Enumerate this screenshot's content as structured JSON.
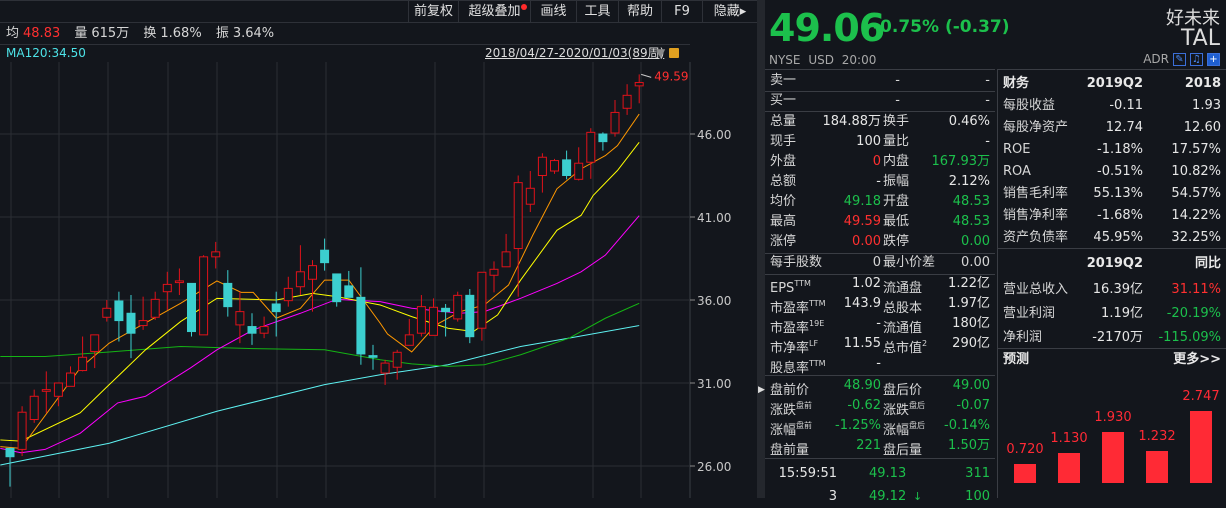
{
  "toolbar": {
    "items": [
      "前复权",
      "超级叠加",
      "画线",
      "工具",
      "帮助",
      "F9",
      "隐藏"
    ]
  },
  "stats": {
    "avg_label": "均",
    "avg": "48.83",
    "vol_label": "量",
    "vol": "615万",
    "turn_label": "换",
    "turn": "1.68%",
    "amp_label": "振",
    "amp": "3.64%"
  },
  "ma_label": "MA120:34.50",
  "date_range": "2018/04/27-2020/01/03(89周)",
  "colors": {
    "up": "#e0121a",
    "down": "#3ccfcf",
    "ma5": "#ff9800",
    "ma10": "#ffff00",
    "ma20": "#ff00ff",
    "ma60": "#14b414",
    "ma120": "#5ef2f2"
  },
  "chart_data": {
    "type": "candlestick",
    "ylim": [
      24,
      50
    ],
    "y_ticks": [
      "46.00",
      "41.00",
      "36.00",
      "31.00",
      "26.00"
    ],
    "y_tick_values": [
      46,
      41,
      36,
      31,
      26
    ],
    "high_label": "49.59",
    "candles": [
      [
        27.06,
        27.1,
        24.76,
        26.56
      ],
      [
        27.0,
        29.6,
        26.6,
        29.24
      ],
      [
        28.8,
        30.6,
        28.6,
        30.2
      ],
      [
        30.5,
        31.7,
        29.2,
        30.6
      ],
      [
        30.2,
        31.0,
        29.6,
        31.0
      ],
      [
        30.8,
        32.0,
        30.8,
        31.6
      ],
      [
        31.75,
        33.8,
        31.7,
        32.55
      ],
      [
        32.9,
        33.9,
        31.9,
        33.9
      ],
      [
        34.96,
        36.0,
        34.7,
        35.5
      ],
      [
        35.94,
        36.5,
        33.5,
        34.76
      ],
      [
        35.2,
        36.3,
        32.5,
        34.0
      ],
      [
        34.46,
        36.2,
        34.2,
        34.76
      ],
      [
        34.96,
        36.5,
        34.8,
        36.04
      ],
      [
        36.5,
        37.7,
        35.4,
        36.94
      ],
      [
        37.05,
        37.9,
        36.3,
        37.15
      ],
      [
        37.0,
        37.0,
        33.8,
        34.1
      ],
      [
        33.9,
        38.7,
        33.9,
        38.6
      ],
      [
        38.6,
        39.5,
        37.9,
        38.9
      ],
      [
        37.0,
        37.8,
        35.0,
        35.6
      ],
      [
        34.5,
        36.5,
        33.4,
        35.3
      ],
      [
        34.4,
        35.2,
        33.3,
        34.0
      ],
      [
        34.0,
        35.0,
        33.7,
        34.4
      ],
      [
        35.76,
        36.5,
        33.8,
        35.3
      ],
      [
        35.96,
        37.4,
        35.6,
        36.7
      ],
      [
        36.8,
        39.3,
        36.3,
        37.7
      ],
      [
        37.25,
        38.4,
        35.3,
        38.07
      ],
      [
        39.0,
        39.7,
        37.77,
        38.25
      ],
      [
        37.57,
        37.57,
        35.6,
        35.9
      ],
      [
        36.85,
        37.75,
        36.16,
        36.16
      ],
      [
        36.16,
        37.97,
        32.1,
        32.75
      ],
      [
        32.65,
        33.3,
        31.8,
        32.55
      ],
      [
        31.6,
        32.4,
        30.88,
        32.2
      ],
      [
        31.95,
        33.0,
        31.2,
        32.85
      ],
      [
        33.27,
        34.86,
        33.27,
        33.9
      ],
      [
        34.0,
        36.3,
        33.8,
        35.6
      ],
      [
        33.87,
        36.1,
        33.87,
        35.56
      ],
      [
        35.5,
        35.76,
        33.8,
        35.3
      ],
      [
        34.86,
        36.5,
        34.7,
        36.28
      ],
      [
        36.28,
        36.66,
        33.4,
        33.79
      ],
      [
        34.3,
        37.67,
        33.55,
        37.67
      ],
      [
        37.49,
        38.33,
        36.46,
        37.85
      ],
      [
        38.0,
        39.98,
        38.0,
        38.9
      ],
      [
        39.1,
        43.5,
        36.2,
        43.07
      ],
      [
        41.77,
        43.77,
        41.3,
        42.73
      ],
      [
        43.5,
        44.84,
        42.47,
        44.6
      ],
      [
        43.77,
        44.5,
        43.6,
        44.4
      ],
      [
        44.44,
        45.0,
        43.27,
        43.5
      ],
      [
        43.27,
        45.2,
        43.2,
        44.24
      ],
      [
        44.3,
        46.35,
        43.3,
        46.1
      ],
      [
        46.0,
        46.1,
        45.0,
        45.54
      ],
      [
        46.06,
        48.05,
        45.84,
        47.3
      ],
      [
        47.55,
        49.0,
        47.15,
        48.33
      ],
      [
        48.9,
        49.59,
        47.85,
        49.1
      ]
    ],
    "ma": {
      "ma5": [
        [
          0.2,
          27.17
        ],
        [
          1.9,
          27.06
        ],
        [
          6.8,
          31.9
        ],
        [
          9.2,
          33.4
        ],
        [
          15.1,
          35.8
        ],
        [
          18.1,
          37.15
        ],
        [
          20.1,
          36.46
        ],
        [
          21.1,
          36.46
        ],
        [
          23,
          34.9
        ],
        [
          25,
          35.5
        ],
        [
          27,
          37.2
        ],
        [
          29,
          37.2
        ],
        [
          31.6,
          34.6
        ],
        [
          32.2,
          33.95
        ],
        [
          34.2,
          32.87
        ],
        [
          36.2,
          34.5
        ],
        [
          38.2,
          35.3
        ],
        [
          40.2,
          35.7
        ],
        [
          42.2,
          36.9
        ],
        [
          44.2,
          39.9
        ],
        [
          46.2,
          42.7
        ],
        [
          48.2,
          43.9
        ],
        [
          50.2,
          44.7
        ],
        [
          51.2,
          45.3
        ],
        [
          53,
          47.2
        ]
      ],
      "ma10": [
        [
          0.2,
          27.57
        ],
        [
          1.9,
          27.5
        ],
        [
          6.8,
          29.2
        ],
        [
          9.2,
          30.9
        ],
        [
          12.2,
          33.0
        ],
        [
          15.1,
          34.7
        ],
        [
          18.1,
          36.1
        ],
        [
          23,
          36.0
        ],
        [
          26,
          36.4
        ],
        [
          28,
          36.2
        ],
        [
          31.6,
          35.7
        ],
        [
          34.2,
          35.0
        ],
        [
          37.2,
          34.3
        ],
        [
          39.3,
          34.1
        ],
        [
          41.3,
          35.1
        ],
        [
          43.2,
          37.2
        ],
        [
          46.2,
          40.2
        ],
        [
          48.2,
          41.1
        ],
        [
          49.2,
          42.3
        ],
        [
          51.2,
          43.8
        ],
        [
          53,
          45.5
        ]
      ],
      "ma20": [
        [
          0.2,
          27.06
        ],
        [
          1.9,
          26.8
        ],
        [
          3.9,
          27.0
        ],
        [
          6.8,
          27.97
        ],
        [
          9.9,
          29.8
        ],
        [
          12.2,
          30.2
        ],
        [
          15.9,
          31.9
        ],
        [
          18.1,
          33.0
        ],
        [
          21.1,
          34.2
        ],
        [
          25,
          35.2
        ],
        [
          28,
          36.04
        ],
        [
          31.6,
          35.9
        ],
        [
          34.2,
          35.5
        ],
        [
          38.2,
          35.2
        ],
        [
          40.2,
          35.3
        ],
        [
          43.2,
          36.1
        ],
        [
          46.2,
          37.0
        ],
        [
          48.2,
          37.7
        ],
        [
          50.2,
          38.7
        ],
        [
          53,
          41.08
        ]
      ],
      "ma60": [
        [
          0.2,
          32.6
        ],
        [
          3.9,
          32.6
        ],
        [
          9.2,
          32.87
        ],
        [
          15.1,
          33.2
        ],
        [
          21.1,
          33.07
        ],
        [
          27,
          33.0
        ],
        [
          31.6,
          32.4
        ],
        [
          34.2,
          32.15
        ],
        [
          37.2,
          32.0
        ],
        [
          40.2,
          32.1
        ],
        [
          43.2,
          32.7
        ],
        [
          47.2,
          33.7
        ],
        [
          50.2,
          34.9
        ],
        [
          53,
          35.8
        ]
      ],
      "ma120": [
        [
          0.2,
          26.06
        ],
        [
          9.2,
          27.37
        ],
        [
          18.1,
          29.3
        ],
        [
          27,
          30.9
        ],
        [
          31.6,
          31.5
        ],
        [
          37.2,
          32.1
        ],
        [
          43.2,
          33.2
        ],
        [
          47.2,
          33.7
        ],
        [
          53,
          34.46
        ]
      ]
    }
  },
  "quote": {
    "price": "49.06",
    "change": "-0.75% (-0.37)",
    "name": "好未来",
    "ticker": "TAL",
    "meta": "NYSE USD 20:00",
    "adr": "ADR"
  },
  "book": [
    {
      "label": "卖一",
      "v1": "-",
      "v2": "-"
    },
    {
      "label": "买一",
      "v1": "-",
      "v2": "-"
    }
  ],
  "table": [
    {
      "l1": "总量",
      "v1": "184.88万",
      "c1": "white",
      "l2": "换手",
      "v2": "0.46%",
      "c2": "white"
    },
    {
      "l1": "现手",
      "v1": "100",
      "c1": "white",
      "l2": "量比",
      "v2": "-",
      "c2": "white"
    },
    {
      "l1": "外盘",
      "v1": "0",
      "c1": "red",
      "l2": "内盘",
      "v2": "167.93万",
      "c2": "green"
    },
    {
      "l1": "总额",
      "v1": "-",
      "c1": "white",
      "l2": "振幅",
      "v2": "2.12%",
      "c2": "white"
    },
    {
      "l1": "均价",
      "v1": "49.18",
      "c1": "green",
      "l2": "开盘",
      "v2": "48.53",
      "c2": "green"
    },
    {
      "l1": "最高",
      "v1": "49.59",
      "c1": "red",
      "l2": "最低",
      "v2": "48.53",
      "c2": "green"
    },
    {
      "l1": "涨停",
      "v1": "0.00",
      "c1": "red",
      "l2": "跌停",
      "v2": "0.00",
      "c2": "green"
    }
  ],
  "lot": {
    "l1": "每手股数",
    "v1": "0",
    "l2": "最小价差",
    "v2": "0.00"
  },
  "valuation": [
    {
      "l1": "EPS",
      "s1": "TTM",
      "v1": "1.02",
      "l2": "流通盘",
      "s2": "",
      "v2": "1.22亿"
    },
    {
      "l1": "市盈率",
      "s1": "TTM",
      "v1": "143.9",
      "l2": "总股本",
      "s2": "",
      "v2": "1.97亿"
    },
    {
      "l1": "市盈率",
      "s1": "19E",
      "v1": "-",
      "l2": "流通值",
      "s2": "",
      "v2": "180亿"
    },
    {
      "l1": "市净率",
      "s1": "LF",
      "v1": "11.55",
      "l2": "总市值",
      "s2": "2",
      "v2": "290亿"
    },
    {
      "l1": "股息率",
      "s1": "TTM",
      "v1": "-",
      "l2": "",
      "s2": "",
      "v2": ""
    }
  ],
  "extended": [
    {
      "l1": "盘前价",
      "s1": "",
      "v1": "48.90",
      "l2": "盘后价",
      "s2": "",
      "v2": "49.00"
    },
    {
      "l1": "涨跌",
      "s1": "盘前",
      "v1": "-0.62",
      "l2": "涨跌",
      "s2": "盘后",
      "v2": "-0.07"
    },
    {
      "l1": "涨幅",
      "s1": "盘前",
      "v1": "-1.25%",
      "l2": "涨幅",
      "s2": "盘后",
      "v2": "-0.14%"
    },
    {
      "l1": "盘前量",
      "s1": "",
      "v1": "221",
      "l2": "盘后量",
      "s2": "",
      "v2": "1.50万"
    }
  ],
  "ticks": [
    {
      "time": "15:59:51",
      "price": "49.13",
      "vol": "311"
    },
    {
      "time": "3",
      "price": "49.12",
      "vol": "100"
    }
  ],
  "finance": {
    "header": [
      "财务",
      "2019Q2",
      "2018"
    ],
    "rows": [
      {
        "l": "每股收益",
        "a": "-0.11",
        "b": "1.93"
      },
      {
        "l": "每股净资产",
        "a": "12.74",
        "b": "12.60"
      },
      {
        "l": "ROE",
        "a": "-1.18%",
        "b": "17.57%"
      },
      {
        "l": "ROA",
        "a": "-0.51%",
        "b": "10.82%"
      },
      {
        "l": "销售毛利率",
        "a": "55.13%",
        "b": "54.57%"
      },
      {
        "l": "销售净利率",
        "a": "-1.68%",
        "b": "14.22%"
      },
      {
        "l": "资产负债率",
        "a": "45.95%",
        "b": "32.25%"
      }
    ],
    "header2": [
      "2019Q2",
      "同比"
    ],
    "rows2": [
      {
        "l": "营业总收入",
        "a": "16.39亿",
        "b": "31.11%",
        "bc": "red"
      },
      {
        "l": "营业利润",
        "a": "1.19亿",
        "b": "-20.19%",
        "bc": "green"
      },
      {
        "l": "净利润",
        "a": "-2170万",
        "b": "-115.09%",
        "bc": "green"
      }
    ]
  },
  "forecast": {
    "title": "预测",
    "more": "更多>>",
    "values": [
      0.72,
      1.13,
      1.93,
      1.232,
      2.747
    ],
    "labels": [
      "0.720",
      "1.130",
      "1.930",
      "1.232",
      "2.747"
    ]
  }
}
